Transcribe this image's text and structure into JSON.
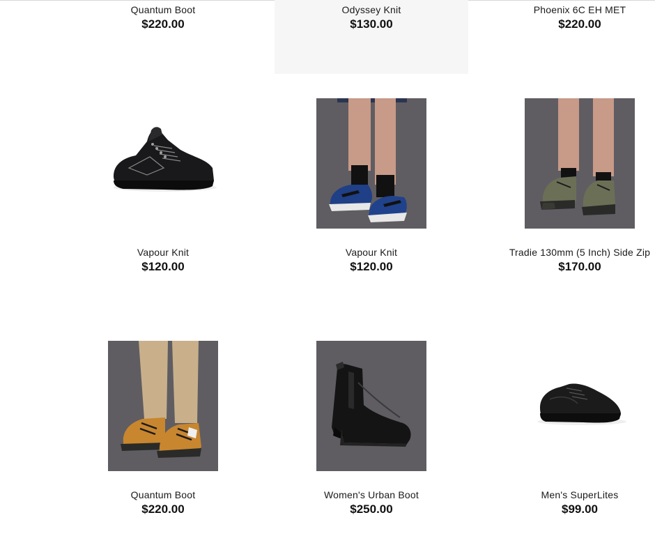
{
  "products": [
    {
      "name": "Quantum Boot",
      "price": "$220.00",
      "image": "tan-work-boot-worn"
    },
    {
      "name": "Odyssey Knit",
      "price": "$130.00",
      "image": "none-visible"
    },
    {
      "name": "Phoenix 6C EH MET",
      "price": "$220.00",
      "image": "none-visible"
    },
    {
      "name": "Vapour Knit",
      "price": "$120.00",
      "image": "black-knit-shoe"
    },
    {
      "name": "Vapour Knit",
      "price": "$120.00",
      "image": "blue-knit-shoe-worn"
    },
    {
      "name": "Tradie 130mm (5 Inch) Side Zip",
      "price": "$170.00",
      "image": "khaki-side-zip-boot-worn"
    },
    {
      "name": "Quantum Boot",
      "price": "$220.00",
      "image": "tan-work-boot-worn"
    },
    {
      "name": "Women's Urban Boot",
      "price": "$250.00",
      "image": "black-chelsea-boot"
    },
    {
      "name": "Men's SuperLites",
      "price": "$99.00",
      "image": "black-lace-up-shoe"
    }
  ],
  "colors": {
    "photo_bg": "#5f5d62",
    "hover_bg": "#f6f6f6",
    "text": "#111111"
  }
}
